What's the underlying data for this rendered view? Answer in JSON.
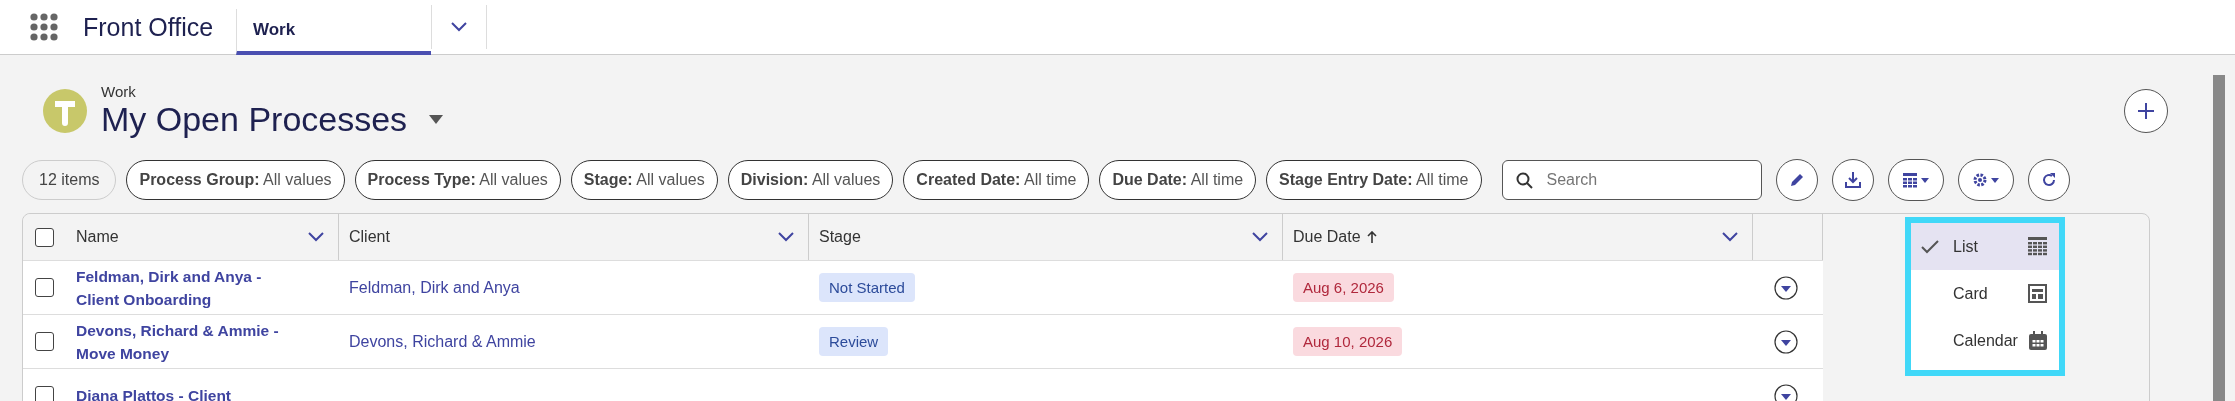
{
  "app": {
    "name": "Front Office"
  },
  "tabs": [
    {
      "label": "Work",
      "selected": true
    }
  ],
  "header": {
    "breadcrumb": "Work",
    "title": "My Open Processes"
  },
  "filters": {
    "count": "12 items",
    "items": [
      {
        "label": "Process Group:",
        "value": "All values"
      },
      {
        "label": "Process Type:",
        "value": "All values"
      },
      {
        "label": "Stage:",
        "value": "All values"
      },
      {
        "label": "Division:",
        "value": "All values"
      },
      {
        "label": "Created Date:",
        "value": "All time"
      },
      {
        "label": "Due Date:",
        "value": "All time"
      },
      {
        "label": "Stage Entry Date:",
        "value": "All time"
      }
    ]
  },
  "search": {
    "placeholder": "Search"
  },
  "view_menu": [
    {
      "label": "List",
      "selected": true,
      "kind": "list"
    },
    {
      "label": "Card",
      "selected": false,
      "kind": "card"
    },
    {
      "label": "Calendar",
      "selected": false,
      "kind": "calendar"
    }
  ],
  "table": {
    "all_checked": false,
    "columns": [
      {
        "label": "Name",
        "sorted": false
      },
      {
        "label": "Client",
        "sorted": false
      },
      {
        "label": "Stage",
        "sorted": false
      },
      {
        "label": "Due Date",
        "sorted": true
      }
    ],
    "rows": [
      {
        "checked": false,
        "name": "Feldman, Dirk and Anya - Client Onboarding",
        "client": "Feldman, Dirk and Anya",
        "stage": "Not Started",
        "due": "Aug 6, 2026"
      },
      {
        "checked": false,
        "name": "Devons, Richard & Ammie - Move Money",
        "client": "Devons, Richard & Ammie",
        "stage": "Review",
        "due": "Aug 10, 2026"
      },
      {
        "checked": false,
        "name": "Diana Plattos - Client"
      }
    ]
  }
}
